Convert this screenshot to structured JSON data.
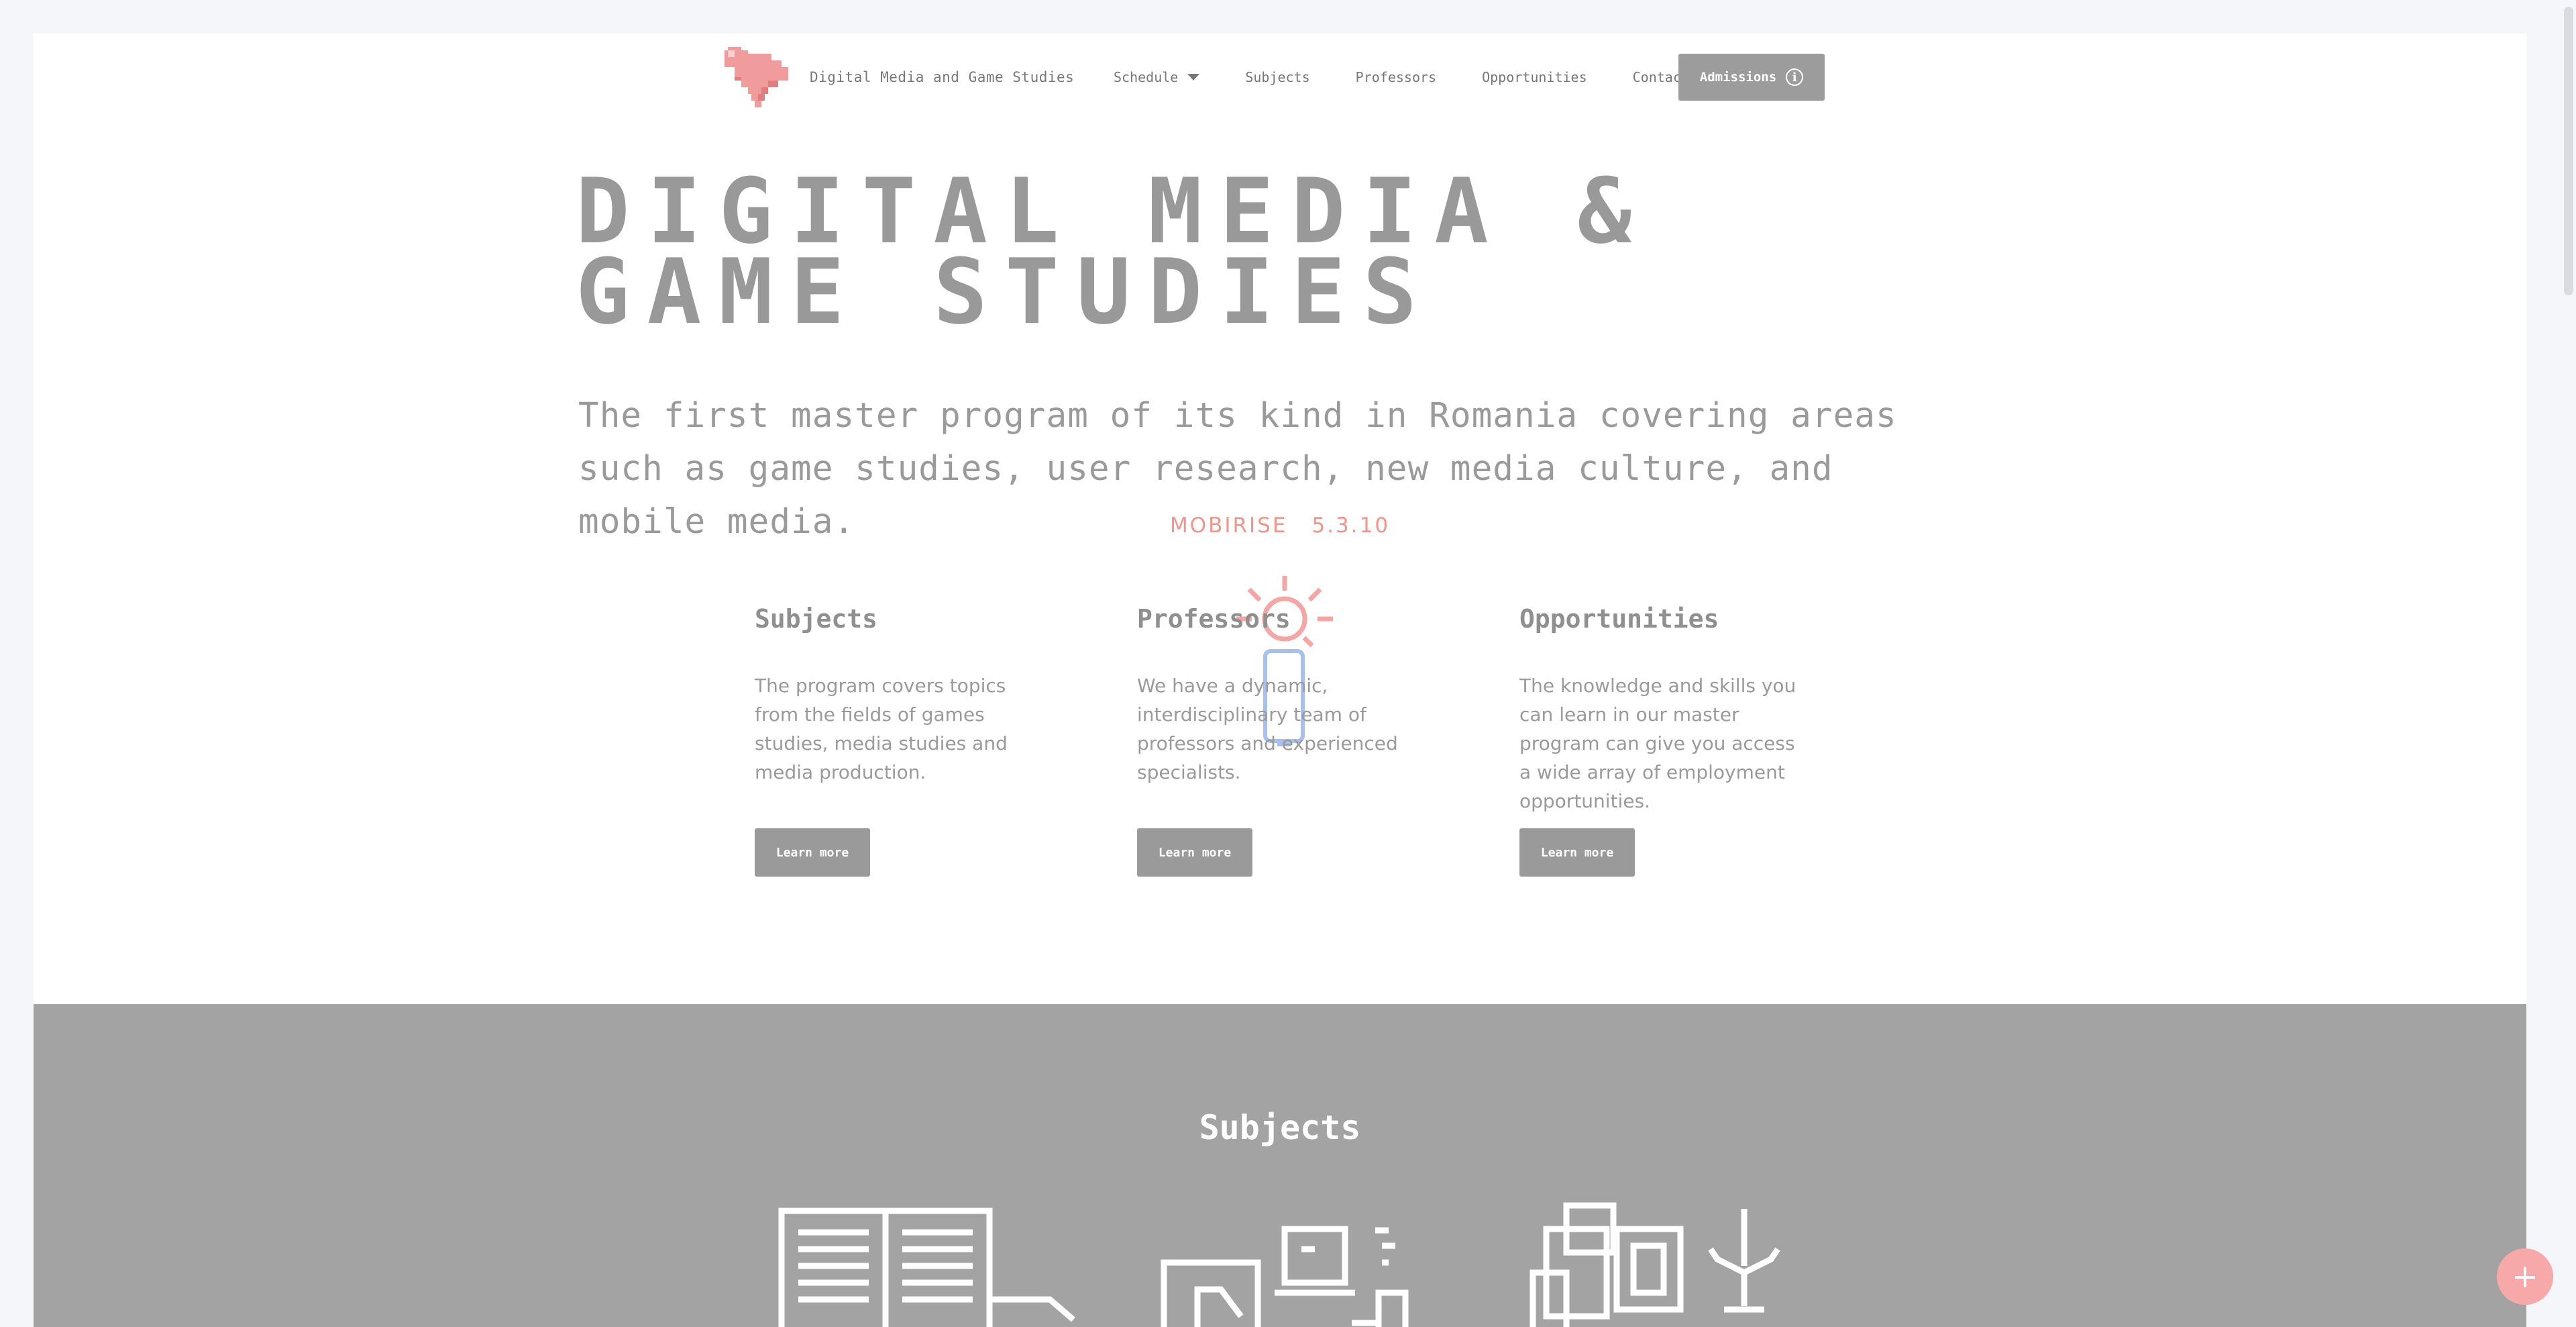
{
  "brand": {
    "name": "Digital Media and Game Studies"
  },
  "nav": {
    "items": [
      {
        "label": "Schedule",
        "dropdown": true
      },
      {
        "label": "Subjects"
      },
      {
        "label": "Professors"
      },
      {
        "label": "Opportunities"
      },
      {
        "label": "Contact"
      }
    ],
    "button_label": "Admissions"
  },
  "hero": {
    "title_line1": "DIGITAL MEDIA &",
    "title_line2": "GAME STUDIES",
    "subtitle": "The first master program of its kind in Romania covering areas such as game studies, user research, new media culture, and mobile media."
  },
  "version": {
    "brand": "MOBIRISE",
    "number": "5.3.10"
  },
  "features": [
    {
      "title": "Subjects",
      "text": "The program covers topics from the fields of games studies, media studies and media production.",
      "button": "Learn more"
    },
    {
      "title": "Professors",
      "text": "We have a dynamic, interdisciplinary team of professors and experienced specialists.",
      "button": "Learn more"
    },
    {
      "title": "Opportunities",
      "text": "The knowledge and skills you can learn in our master program can give you access a wide array of employment opportunities.",
      "button": "Learn more"
    }
  ],
  "subjects_section": {
    "title": "Subjects"
  },
  "colors": {
    "accent": "#f1948a",
    "button_gray": "#9a9a9a",
    "section_gray": "#a3a3a3",
    "page_bg": "#f4f6fa"
  },
  "icons": {
    "logo": "pixel-heart-icon",
    "info": "info-icon",
    "feature_decor": "lightbulb-icon",
    "fab": "plus-icon"
  }
}
